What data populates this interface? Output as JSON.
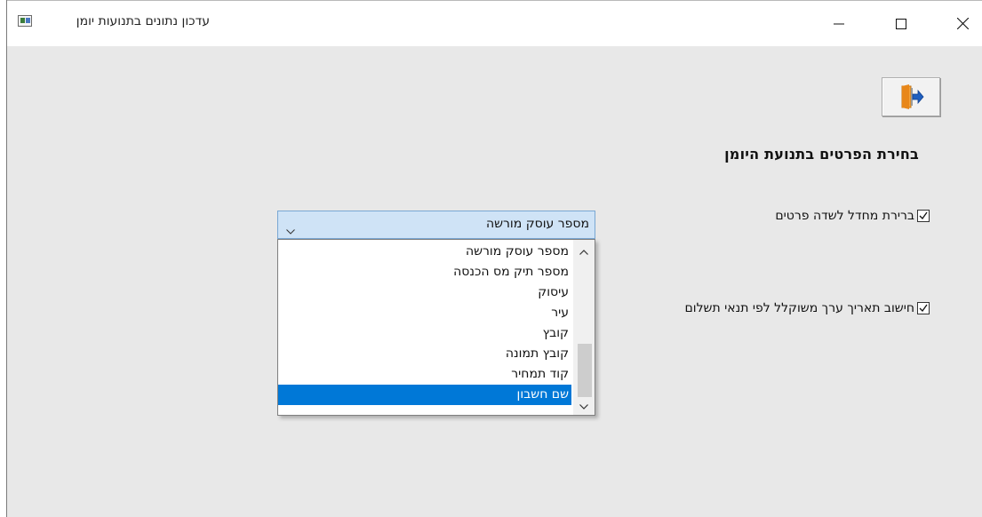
{
  "window": {
    "title": "עדכון נתונים בתנועות יומן",
    "controls": {
      "minimize_icon": "minimize-icon",
      "maximize_icon": "maximize-icon",
      "close_icon": "close-icon"
    }
  },
  "toolbar": {
    "exit_icon": "exit-door-icon"
  },
  "section": {
    "title": "בחירת הפרטים בתנועת היומן"
  },
  "options": [
    {
      "label": "ברירת מחדל לשדה פרטים",
      "checked": true
    },
    {
      "label": "חישוב תאריך ערך משוקלל לפי תנאי תשלום",
      "checked": true
    }
  ],
  "combo": {
    "value": "מספר עוסק מורשה",
    "items": [
      "מספר עוסק מורשה",
      "מספר תיק מס הכנסה",
      "עיסוק",
      "עיר",
      "קובץ",
      "קובץ תמונה",
      "קוד תמחיר",
      "שם חשבון"
    ],
    "selected_index": 7
  },
  "colors": {
    "selection": "#0078d7",
    "combo_bg": "#cfe3f6",
    "window_bg": "#e8e8e8"
  }
}
